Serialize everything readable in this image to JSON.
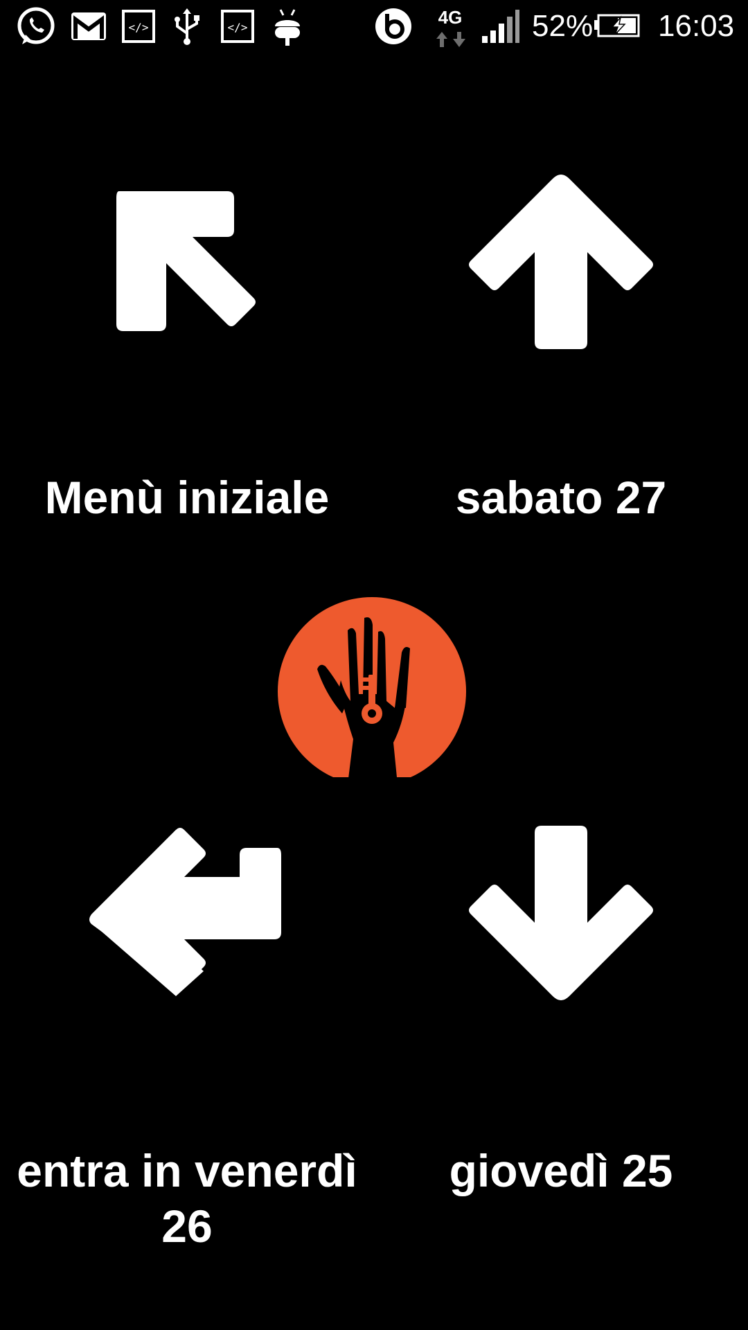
{
  "status_bar": {
    "battery_percent": "52%",
    "time": "16:03",
    "network": "4G",
    "icons": [
      "whatsapp-icon",
      "gmail-icon",
      "code-icon",
      "usb-icon",
      "code-icon",
      "android-debug-icon",
      "beats-icon",
      "network-4g-icon",
      "signal-icon",
      "battery-charging-icon"
    ]
  },
  "nav": {
    "top_left": {
      "label": "Menù iniziale",
      "icon": "arrow-up-left-icon"
    },
    "top_right": {
      "label": "sabato 27",
      "icon": "arrow-up-icon"
    },
    "bottom_left": {
      "label": "entra in venerdì 26",
      "icon": "arrow-return-left-icon"
    },
    "bottom_right": {
      "label": "giovedì 25",
      "icon": "arrow-down-icon"
    }
  },
  "center_logo": {
    "icon": "hand-key-logo-icon",
    "color": "#EE5A2E"
  },
  "colors": {
    "background": "#000000",
    "foreground": "#FFFFFF",
    "accent": "#EE5A2E"
  }
}
